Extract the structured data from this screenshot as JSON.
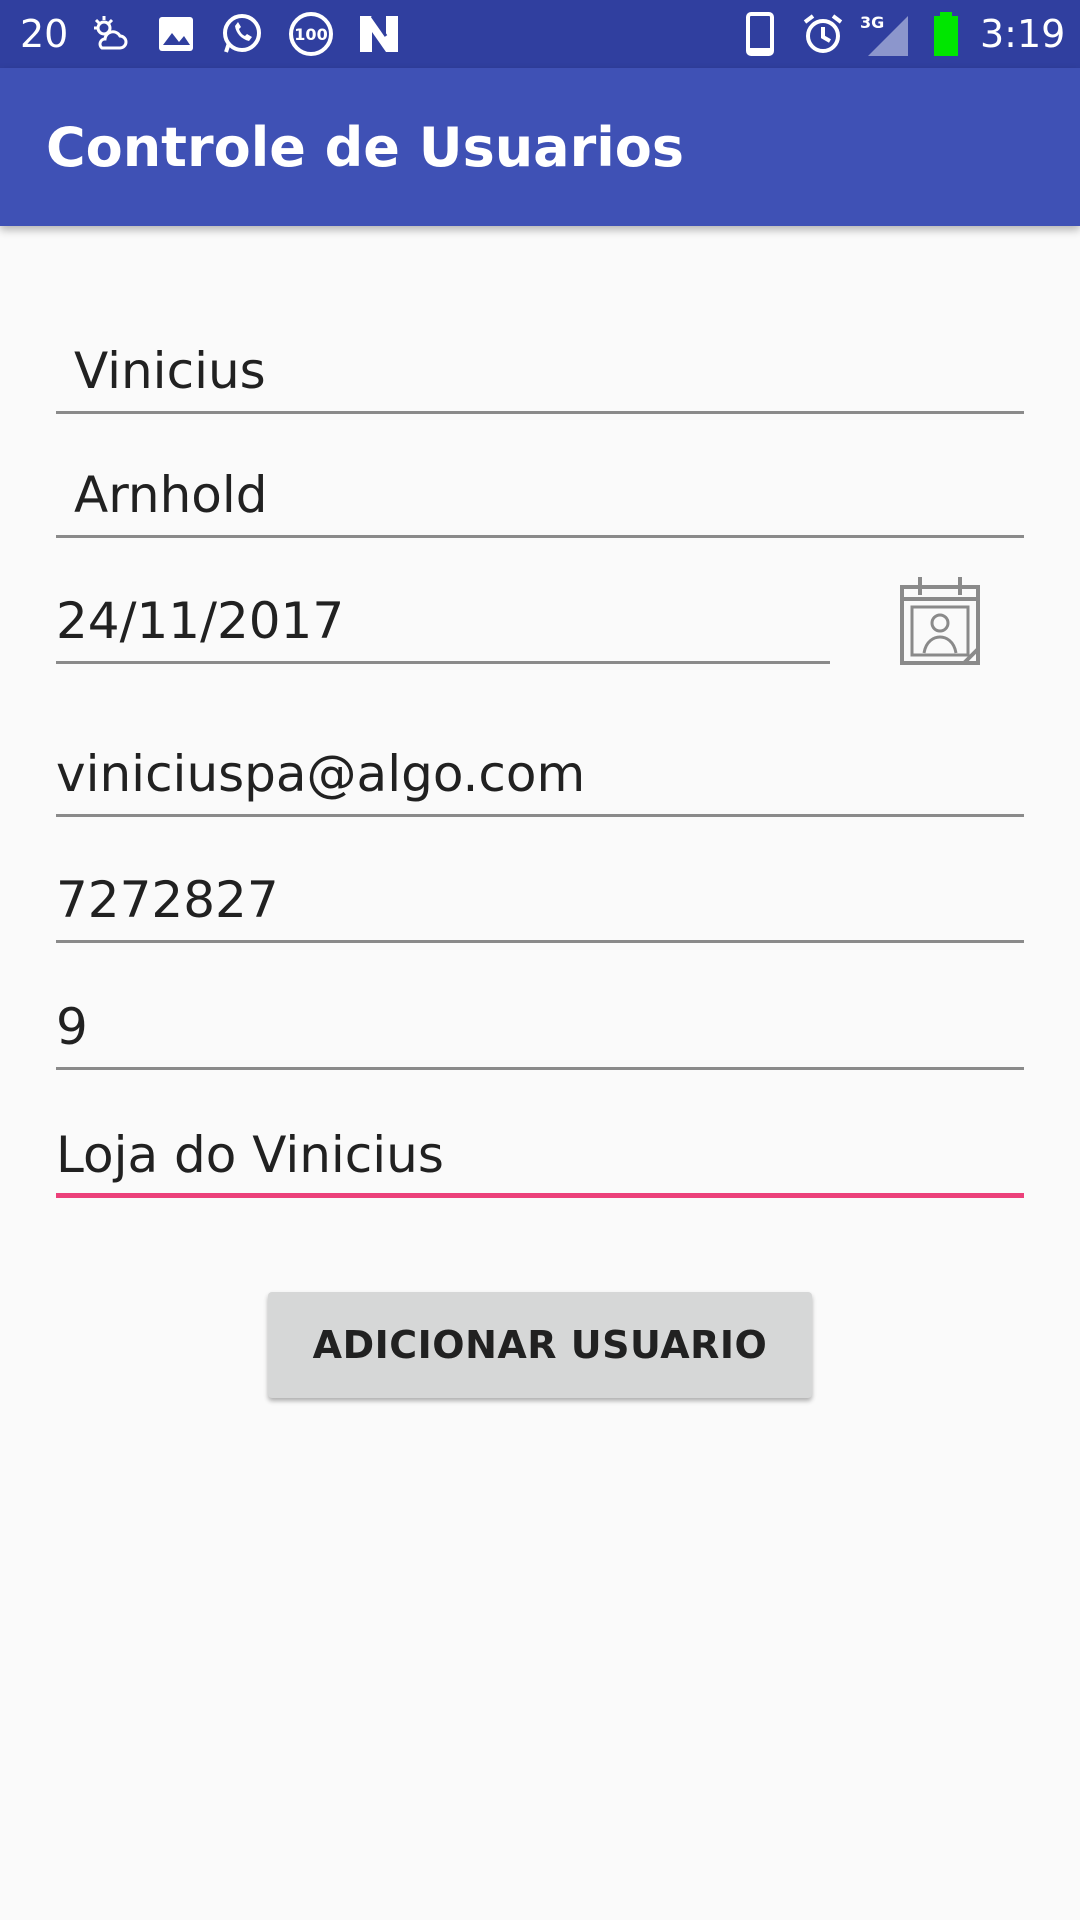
{
  "status_bar": {
    "left_number": "20",
    "left_icons": [
      "weather-icon",
      "image-icon",
      "whatsapp-icon",
      "badge-100-icon",
      "n-icon"
    ],
    "badge_text": "100",
    "right_icons": [
      "phone-icon",
      "alarm-icon",
      "signal-3g-icon",
      "battery-icon"
    ],
    "signal_label": "3G",
    "time": "3:19"
  },
  "app_bar": {
    "title": "Controle de Usuarios"
  },
  "form": {
    "first_name": "Vinicius",
    "last_name": "Arnhold",
    "birth_date": "24/11/2017",
    "email": "viniciuspa@algo.com",
    "phone": "7272827",
    "number": "9",
    "store": "Loja do Vinicius"
  },
  "calendar_button": {
    "icon": "calendar-icon"
  },
  "primary_button": {
    "label": "ADICIONAR USUARIO"
  },
  "colors": {
    "status_bar": "#303f9f",
    "app_bar": "#3f51b5",
    "accent": "#ec407a",
    "background": "#fafafa",
    "button": "#d6d7d7"
  }
}
